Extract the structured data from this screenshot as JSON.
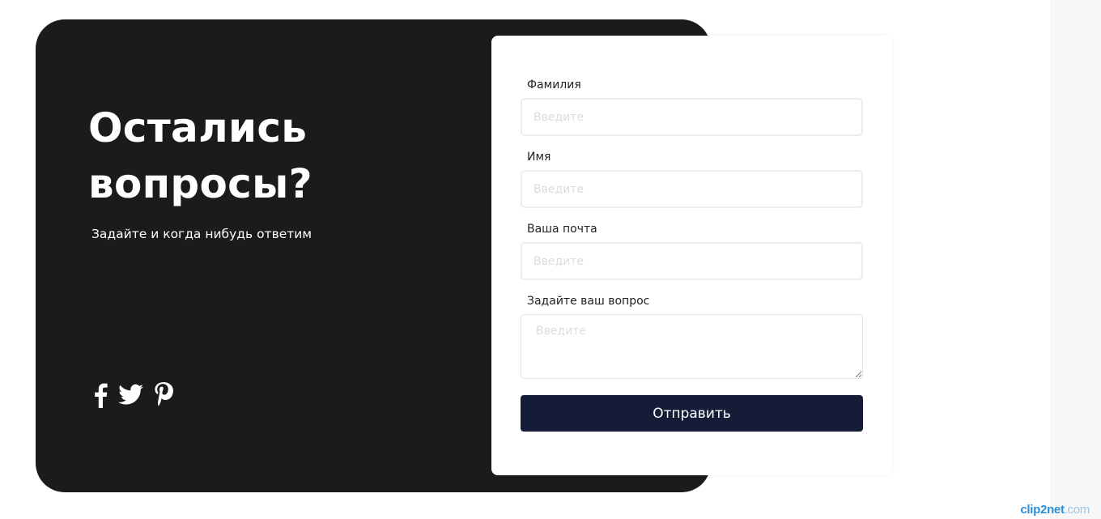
{
  "contact": {
    "heading_line1": "Остались",
    "heading_line2": "вопросы?",
    "subtitle": "Задайте и когда нибудь ответим",
    "social": [
      {
        "icon": "facebook-icon"
      },
      {
        "icon": "twitter-icon"
      },
      {
        "icon": "pinterest-icon"
      }
    ]
  },
  "form": {
    "fields": [
      {
        "label": "Фамилия",
        "placeholder": "Введите",
        "value": ""
      },
      {
        "label": "Имя",
        "placeholder": "Введите",
        "value": ""
      },
      {
        "label": "Ваша почта",
        "placeholder": "Введите",
        "value": ""
      },
      {
        "label": "Задайте ваш вопрос",
        "placeholder": "Введите",
        "value": ""
      }
    ],
    "submit_label": "Отправить"
  },
  "watermark": {
    "part1": "clip2net",
    "part2": ".com"
  },
  "colors": {
    "panel_bg": "#1b1b1c",
    "button_bg": "#151c38",
    "text_light": "#ffffff"
  }
}
